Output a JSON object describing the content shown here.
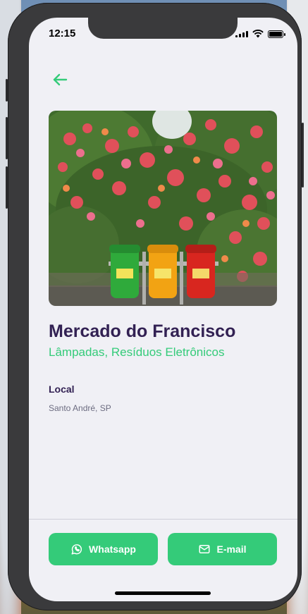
{
  "status_bar": {
    "time": "12:15"
  },
  "point": {
    "name": "Mercado do Francisco",
    "items": "Lâmpadas, Resíduos Eletrônicos",
    "address_label": "Local",
    "address": "Santo André, SP"
  },
  "buttons": {
    "whatsapp": "Whatsapp",
    "email": "E-mail"
  },
  "colors": {
    "primary": "#34cb79",
    "title": "#322153",
    "text": "#6c6c80",
    "background": "#f0f0f5"
  },
  "icons": {
    "back": "arrow-left-icon",
    "whatsapp": "whatsapp-icon",
    "email": "mail-icon"
  }
}
